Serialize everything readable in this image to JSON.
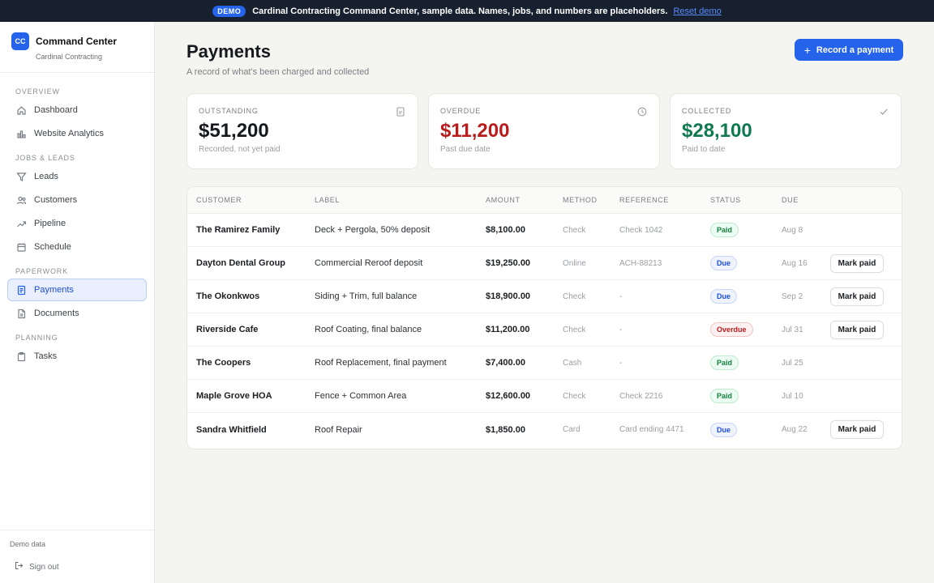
{
  "banner": {
    "pill": "DEMO",
    "message": "Cardinal Contracting Command Center, sample data. Names, jobs, and numbers are placeholders.",
    "reset_label": "Reset demo"
  },
  "brand": {
    "logo": "CC",
    "title": "Command Center",
    "subtitle": "Cardinal Contracting"
  },
  "sidebar": {
    "sections": [
      "OVERVIEW",
      "JOBS & LEADS",
      "PAPERWORK",
      "PLANNING"
    ],
    "items": [
      {
        "label": "Dashboard",
        "icon": "home-icon"
      },
      {
        "label": "Website Analytics",
        "icon": "bar-chart-icon"
      },
      {
        "label": "Leads",
        "icon": "funnel-icon"
      },
      {
        "label": "Customers",
        "icon": "users-icon"
      },
      {
        "label": "Pipeline",
        "icon": "trend-icon"
      },
      {
        "label": "Schedule",
        "icon": "calendar-icon"
      },
      {
        "label": "Payments",
        "icon": "receipt-icon",
        "active": true
      },
      {
        "label": "Documents",
        "icon": "document-icon"
      },
      {
        "label": "Tasks",
        "icon": "clipboard-icon"
      }
    ],
    "footer_note": "Demo data",
    "sign_out": "Sign out"
  },
  "page": {
    "title": "Payments",
    "subtitle": "A record of what's been charged and collected",
    "record_button": "Record a payment"
  },
  "cards": [
    {
      "label": "OUTSTANDING",
      "value": "$51,200",
      "note": "Recorded, not yet paid",
      "color": "#16191d",
      "icon": "receipt-icon"
    },
    {
      "label": "OVERDUE",
      "value": "$11,200",
      "note": "Past due date",
      "color": "#b91c1c",
      "icon": "clock-icon"
    },
    {
      "label": "COLLECTED",
      "value": "$28,100",
      "note": "Paid to date",
      "color": "#0f7a4f",
      "icon": "check-icon"
    }
  ],
  "table": {
    "headers": [
      "CUSTOMER",
      "LABEL",
      "AMOUNT",
      "METHOD",
      "REFERENCE",
      "STATUS",
      "DUE"
    ],
    "mark_paid_label": "Mark paid",
    "rows": [
      {
        "customer": "The Ramirez Family",
        "label": "Deck + Pergola, 50% deposit",
        "amount": "$8,100.00",
        "method": "Check",
        "reference": "Check 1042",
        "status": "Paid",
        "due": "Aug 8"
      },
      {
        "customer": "Dayton Dental Group",
        "label": "Commercial Reroof deposit",
        "amount": "$19,250.00",
        "method": "Online",
        "reference": "ACH-88213",
        "status": "Due",
        "due": "Aug 16"
      },
      {
        "customer": "The Okonkwos",
        "label": "Siding + Trim, full balance",
        "amount": "$18,900.00",
        "method": "Check",
        "reference": "-",
        "status": "Due",
        "due": "Sep 2"
      },
      {
        "customer": "Riverside Cafe",
        "label": "Roof Coating, final balance",
        "amount": "$11,200.00",
        "method": "Check",
        "reference": "-",
        "status": "Overdue",
        "due": "Jul 31"
      },
      {
        "customer": "The Coopers",
        "label": "Roof Replacement, final payment",
        "amount": "$7,400.00",
        "method": "Cash",
        "reference": "-",
        "status": "Paid",
        "due": "Jul 25"
      },
      {
        "customer": "Maple Grove HOA",
        "label": "Fence + Common Area",
        "amount": "$12,600.00",
        "method": "Check",
        "reference": "Check 2216",
        "status": "Paid",
        "due": "Jul 10"
      },
      {
        "customer": "Sandra Whitfield",
        "label": "Roof Repair",
        "amount": "$1,850.00",
        "method": "Card",
        "reference": "Card ending 4471",
        "status": "Due",
        "due": "Aug 22"
      }
    ]
  }
}
